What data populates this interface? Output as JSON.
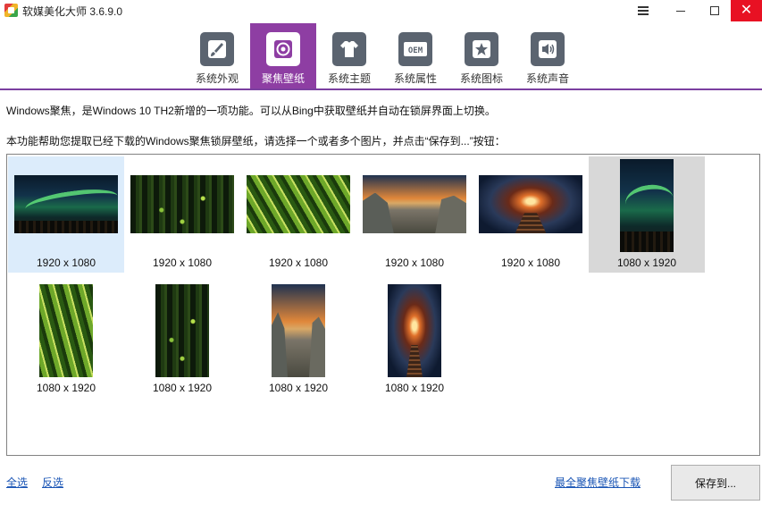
{
  "window": {
    "title": "软媒美化大师 3.6.9.0",
    "icons": {
      "app": "app-logo-icon",
      "menu": "hamburger-menu-icon",
      "minimize": "minimize-icon",
      "maximize": "maximize-icon",
      "close": "close-icon"
    },
    "close_glyph": "✕"
  },
  "toolbar": {
    "active_color": "#8e3ea3",
    "tabs": [
      {
        "label": "系统外观",
        "icon": "paintbrush-icon"
      },
      {
        "label": "聚焦壁纸",
        "icon": "focus-target-icon",
        "active": true
      },
      {
        "label": "系统主题",
        "icon": "tshirt-icon"
      },
      {
        "label": "系统属性",
        "icon": "oem-icon",
        "icon_text": "OEM"
      },
      {
        "label": "系统图标",
        "icon": "star-icon"
      },
      {
        "label": "系统声音",
        "icon": "speaker-icon"
      }
    ]
  },
  "main": {
    "description": "Windows聚焦，是Windows 10 TH2新增的一项功能。可以从Bing中获取壁纸并自动在锁屏界面上切换。",
    "instruction": "本功能帮助您提取已经下载的Windows聚焦锁屏壁纸，请选择一个或者多个图片，并点击“保存到...”按钮："
  },
  "gallery": {
    "items": [
      {
        "resolution": "1920 x 1080",
        "subject": "aurora",
        "state": "selected"
      },
      {
        "resolution": "1920 x 1080",
        "subject": "forest-fireflies"
      },
      {
        "resolution": "1920 x 1080",
        "subject": "palm-leaf"
      },
      {
        "resolution": "1920 x 1080",
        "subject": "rock-sunset"
      },
      {
        "resolution": "1920 x 1080",
        "subject": "tunnel"
      },
      {
        "resolution": "1080 x 1920",
        "subject": "aurora",
        "state": "hover"
      },
      {
        "resolution": "1080 x 1920",
        "subject": "palm-leaf"
      },
      {
        "resolution": "1080 x 1920",
        "subject": "forest-fireflies"
      },
      {
        "resolution": "1080 x 1920",
        "subject": "rock-sunset"
      },
      {
        "resolution": "1080 x 1920",
        "subject": "tunnel"
      }
    ]
  },
  "footer": {
    "select_all": "全选",
    "invert_selection": "反选",
    "download_link": "最全聚焦壁纸下载",
    "save_button": "保存到..."
  }
}
